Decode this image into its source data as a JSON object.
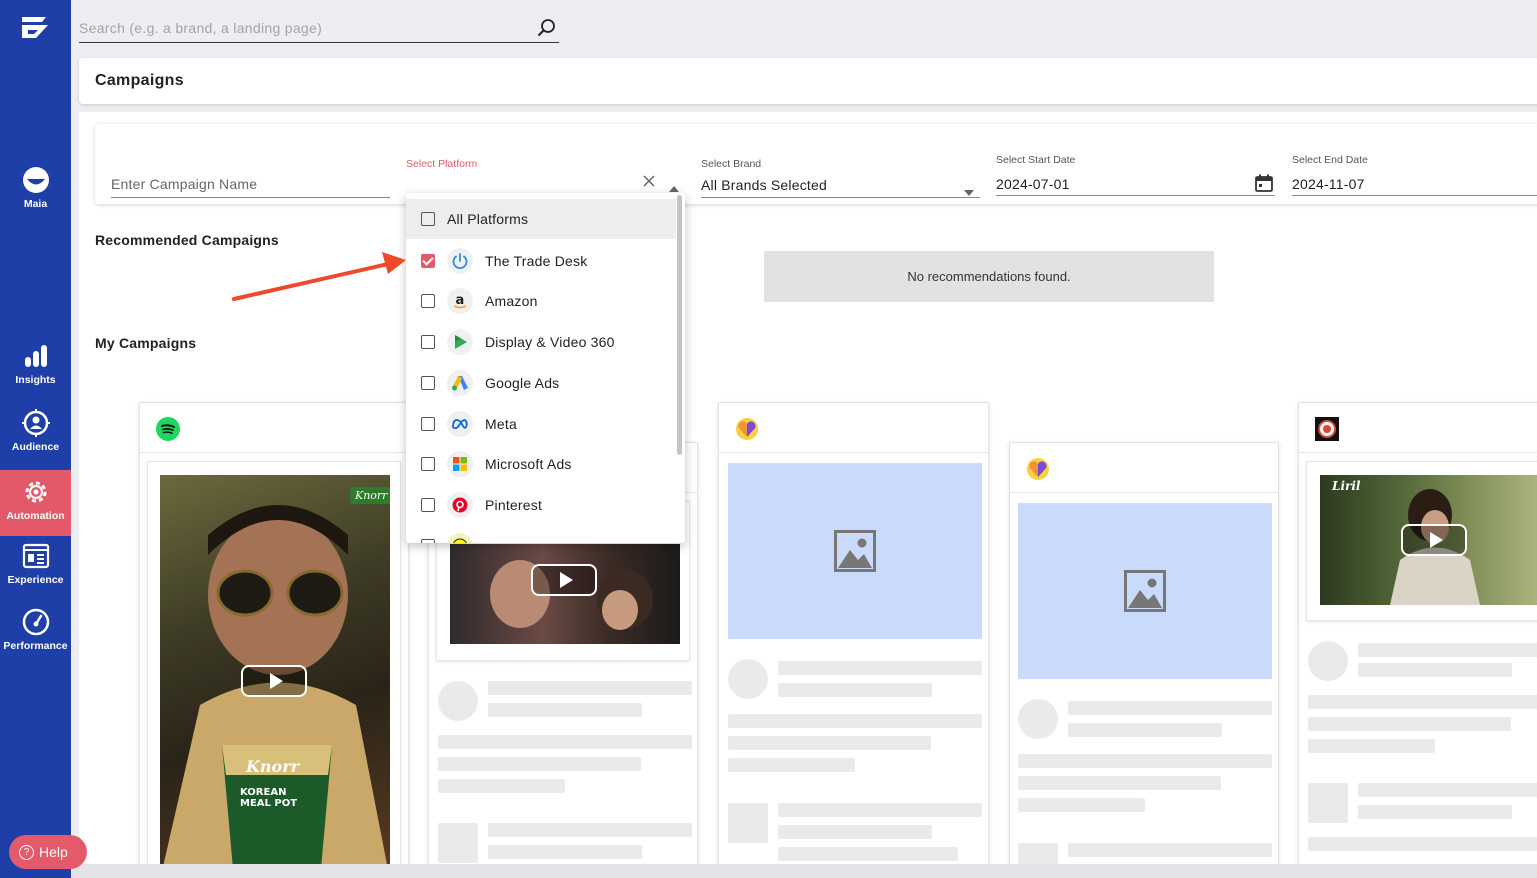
{
  "sidebar": {
    "items": [
      {
        "label": "Maia",
        "icon": "maia-icon"
      },
      {
        "label": "Insights",
        "icon": "bar-chart-icon"
      },
      {
        "label": "Audience",
        "icon": "target-user-icon"
      },
      {
        "label": "Automation",
        "icon": "gear-icon"
      },
      {
        "label": "Experience",
        "icon": "newspaper-icon"
      },
      {
        "label": "Performance",
        "icon": "gauge-icon"
      }
    ],
    "active": "Automation",
    "help_label": "Help",
    "color": "#1f3fa8",
    "active_color": "#e25a6a"
  },
  "search": {
    "placeholder": "Search (e.g. a brand, a landing page)"
  },
  "page": {
    "title": "Campaigns"
  },
  "filters": {
    "campaign_name_placeholder": "Enter Campaign Name",
    "platform_label": "Select Platform",
    "brand_label": "Select Brand",
    "brand_value": "All Brands Selected",
    "start_label": "Select Start Date",
    "start_value": "2024-07-01",
    "end_label": "Select End Date",
    "end_value": "2024-11-07"
  },
  "platform_dropdown": {
    "options": [
      {
        "label": "All Platforms",
        "checked": false
      },
      {
        "label": "The Trade Desk",
        "checked": true
      },
      {
        "label": "Amazon",
        "checked": false
      },
      {
        "label": "Display & Video 360",
        "checked": false
      },
      {
        "label": "Google Ads",
        "checked": false
      },
      {
        "label": "Meta",
        "checked": false
      },
      {
        "label": "Microsoft Ads",
        "checked": false
      },
      {
        "label": "Pinterest",
        "checked": false
      }
    ]
  },
  "sections": {
    "recommended_title": "Recommended Campaigns",
    "no_recommendations": "No recommendations found.",
    "my_campaigns_title": "My Campaigns"
  },
  "ad_text": {
    "knorr_logo": "Knorr",
    "knorr_cup": "Knorr",
    "knorr_product": "KOREAN MEAL POT",
    "liril_logo": "Liril"
  }
}
